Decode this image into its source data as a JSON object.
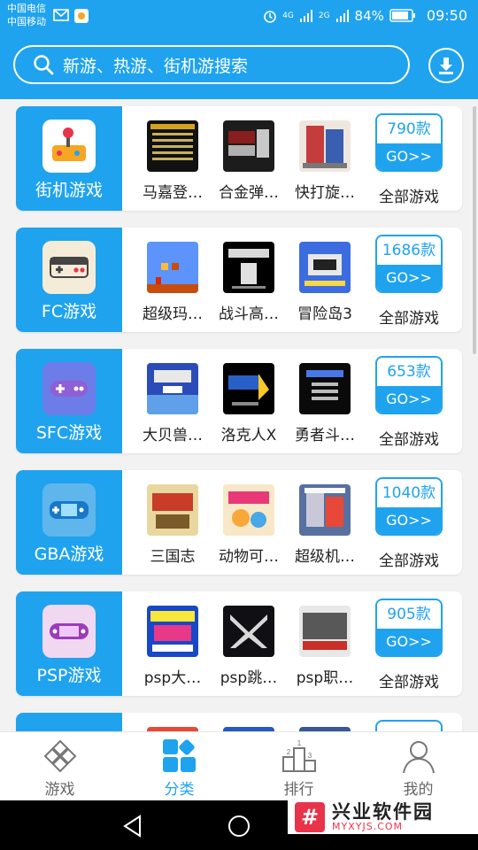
{
  "status_bar": {
    "carrier1": "中国电信",
    "carrier2": "中国移动",
    "signal1": "4G",
    "signal2": "2G",
    "battery": "84%",
    "time": "09:50"
  },
  "search": {
    "placeholder": "新游、热游、街机游搜索"
  },
  "categories": [
    {
      "label": "街机游戏",
      "games": [
        "马嘉登…",
        "合金弹…",
        "快打旋…"
      ],
      "count": "790款",
      "go": "GO>>",
      "all": "全部游戏"
    },
    {
      "label": "FC游戏",
      "games": [
        "超级玛…",
        "战斗高…",
        "冒险岛3"
      ],
      "count": "1686款",
      "go": "GO>>",
      "all": "全部游戏"
    },
    {
      "label": "SFC游戏",
      "games": [
        "大贝兽…",
        "洛克人X",
        "勇者斗…"
      ],
      "count": "653款",
      "go": "GO>>",
      "all": "全部游戏"
    },
    {
      "label": "GBA游戏",
      "games": [
        "三国志",
        "动物可…",
        "超级机…"
      ],
      "count": "1040款",
      "go": "GO>>",
      "all": "全部游戏"
    },
    {
      "label": "PSP游戏",
      "games": [
        "psp大…",
        "psp跳…",
        "psp职…"
      ],
      "count": "905款",
      "go": "GO>>",
      "all": "全部游戏"
    }
  ],
  "tabs": [
    {
      "label": "游戏",
      "icon": "gamepad-icon"
    },
    {
      "label": "分类",
      "icon": "category-grid-icon"
    },
    {
      "label": "排行",
      "icon": "podium-icon"
    },
    {
      "label": "我的",
      "icon": "user-icon"
    }
  ],
  "watermark": {
    "title": "兴业软件园",
    "url": "MYXYJS.COM"
  },
  "colors": {
    "accent": "#1fa3ef",
    "background": "#f2f2f2"
  }
}
